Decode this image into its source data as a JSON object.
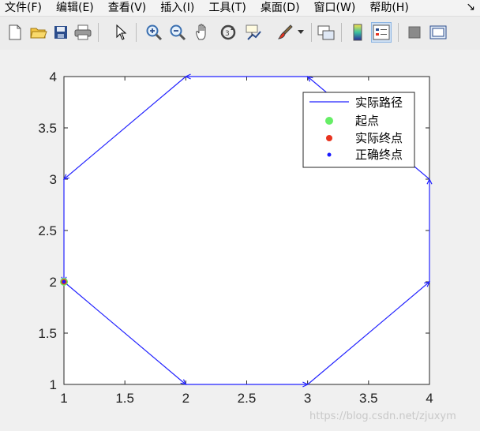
{
  "menu": {
    "items": [
      "文件(F)",
      "编辑(E)",
      "查看(V)",
      "插入(I)",
      "工具(T)",
      "桌面(D)",
      "窗口(W)",
      "帮助(H)"
    ]
  },
  "toolbar": {
    "icons": [
      "new-figure-icon",
      "open-file-icon",
      "save-icon",
      "print-icon",
      "pointer-icon",
      "zoom-in-icon",
      "zoom-out-icon",
      "pan-hand-icon",
      "rotate-3d-icon",
      "data-cursor-icon",
      "brush-icon",
      "brush-dropdown-icon",
      "link-plot-icon",
      "colorbar-icon",
      "legend-icon",
      "hide-plot-tools-icon",
      "show-plot-tools-icon"
    ]
  },
  "watermark": "https://blog.csdn.net/zjuxym",
  "colors": {
    "path": "#2222ff",
    "start": "#66ee66",
    "actual_end": "#e8331f",
    "expected_end": "#1a1aff"
  },
  "chart_data": {
    "type": "line",
    "xlim": [
      1,
      4
    ],
    "ylim": [
      1,
      4
    ],
    "xticks": [
      "1",
      "1.5",
      "2",
      "2.5",
      "3",
      "3.5",
      "4"
    ],
    "yticks": [
      "1",
      "1.5",
      "2",
      "2.5",
      "3",
      "3.5",
      "4"
    ],
    "grid": false,
    "legend_position": "top-right",
    "series": [
      {
        "name": "实际路径",
        "x": [
          1,
          2,
          3,
          4,
          4,
          3,
          2,
          1,
          1
        ],
        "y": [
          2,
          1,
          1,
          2,
          3,
          4,
          4,
          3,
          2
        ]
      }
    ],
    "points": [
      {
        "name": "起点",
        "x": 1,
        "y": 2
      },
      {
        "name": "实际终点",
        "x": 1,
        "y": 2
      },
      {
        "name": "正确终点",
        "x": 1,
        "y": 2
      }
    ]
  }
}
